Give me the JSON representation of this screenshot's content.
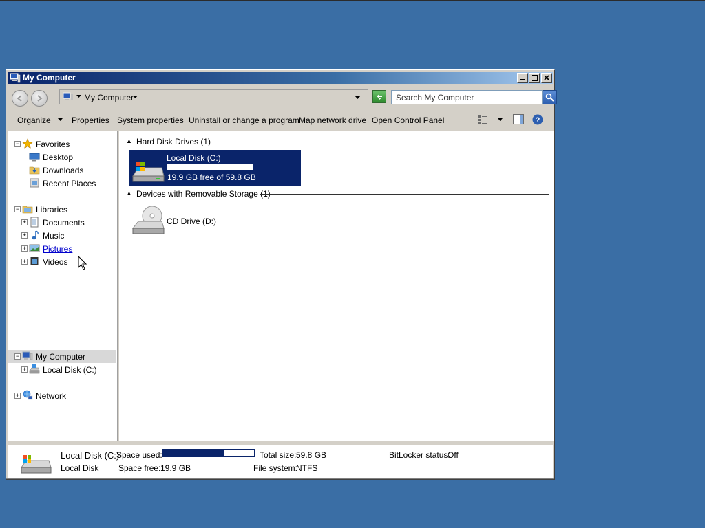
{
  "window": {
    "title": "My Computer"
  },
  "address": {
    "crumb": "My Computer",
    "search_placeholder": "Search My Computer"
  },
  "commands": [
    "Organize",
    "Properties",
    "System properties",
    "Uninstall or change a program",
    "Map network drive",
    "Open Control Panel"
  ],
  "nav": {
    "favorites": {
      "label": "Favorites",
      "items": [
        "Desktop",
        "Downloads",
        "Recent Places"
      ]
    },
    "libraries": {
      "label": "Libraries",
      "items": [
        "Documents",
        "Music",
        "Pictures",
        "Videos"
      ]
    },
    "computer": {
      "label": "My Computer",
      "items": [
        "Local Disk (C:)"
      ]
    },
    "network": {
      "label": "Network"
    }
  },
  "content": {
    "hdd_group": "Hard Disk Drives (1)",
    "removable_group": "Devices with Removable Storage (1)",
    "local_disk": {
      "name": "Local Disk (C:)",
      "free_text": "19.9 GB free of 59.8 GB",
      "used_fraction": 0.667
    },
    "cd_drive": {
      "name": "CD Drive (D:)"
    }
  },
  "details": {
    "name": "Local Disk (C:)",
    "type": "Local Disk",
    "space_used_label": "Space used:",
    "space_free_label": "Space free:",
    "space_free_value": "19.9 GB",
    "total_size_label": "Total size:",
    "total_size_value": "59.8 GB",
    "filesystem_label": "File system:",
    "filesystem_value": "NTFS",
    "bitlocker_label": "BitLocker status:",
    "bitlocker_value": "Off",
    "used_fraction": 0.667
  },
  "colors": {
    "desktop": "#3a6ea5",
    "selection": "#0a246a"
  }
}
